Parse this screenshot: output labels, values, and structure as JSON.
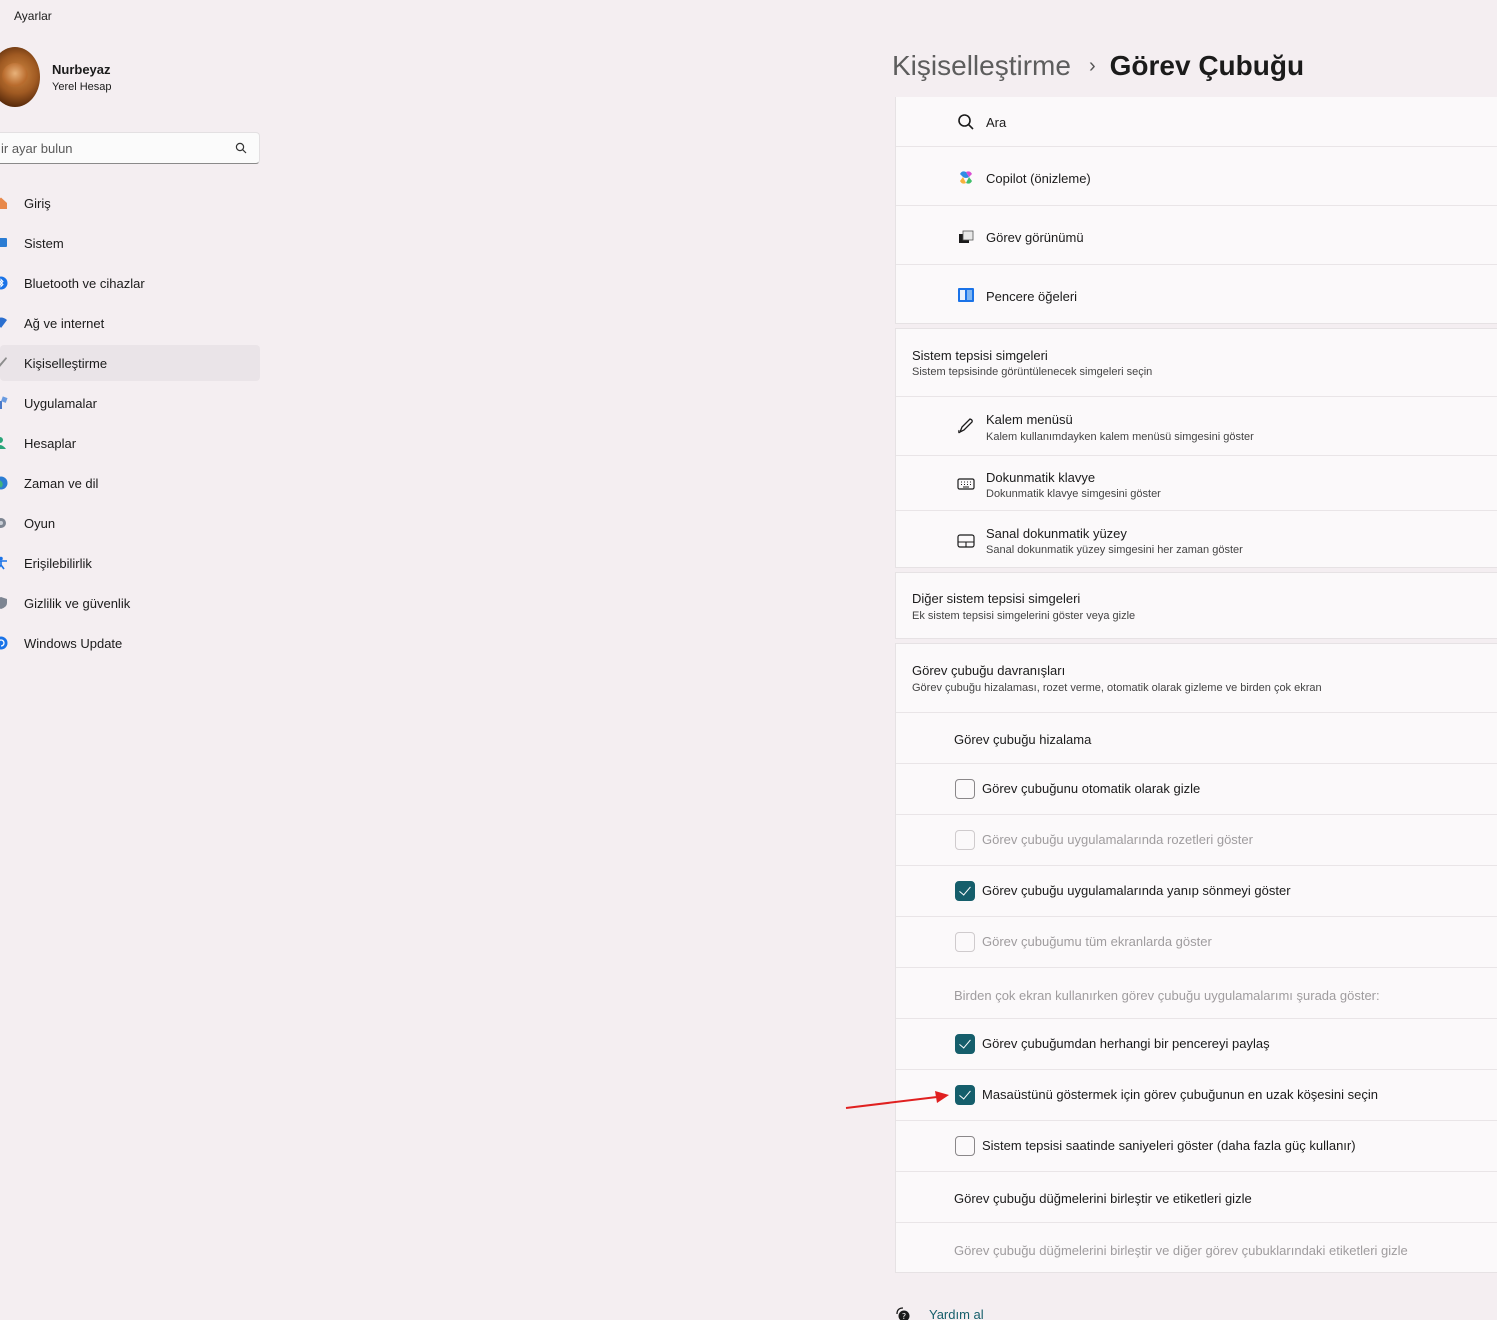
{
  "window": {
    "title": "Ayarlar"
  },
  "profile": {
    "name": "Nurbeyaz",
    "account": "Yerel Hesap"
  },
  "search": {
    "placeholder": "ir ayar bulun"
  },
  "sidebar": {
    "items": [
      {
        "label": "Giriş",
        "icon": "home-icon",
        "color": "#e07a3a"
      },
      {
        "label": "Sistem",
        "icon": "system-icon",
        "color": "#2b7cd3"
      },
      {
        "label": "Bluetooth ve cihazlar",
        "icon": "bluetooth-icon",
        "color": "#1a73e8"
      },
      {
        "label": "Ağ ve internet",
        "icon": "network-icon",
        "color": "#2b6fcf"
      },
      {
        "label": "Kişiselleştirme",
        "icon": "brush-icon",
        "color": "#888888",
        "active": true
      },
      {
        "label": "Uygulamalar",
        "icon": "apps-icon",
        "color": "#4b79c9"
      },
      {
        "label": "Hesaplar",
        "icon": "accounts-icon",
        "color": "#2aa57a"
      },
      {
        "label": "Zaman ve dil",
        "icon": "globe-icon",
        "color": "#2b7cd3"
      },
      {
        "label": "Oyun",
        "icon": "gamepad-icon",
        "color": "#7d8592"
      },
      {
        "label": "Erişilebilirlik",
        "icon": "accessibility-icon",
        "color": "#1a73e8"
      },
      {
        "label": "Gizlilik ve güvenlik",
        "icon": "shield-icon",
        "color": "#7d8592"
      },
      {
        "label": "Windows Update",
        "icon": "update-icon",
        "color": "#1a73e8"
      }
    ]
  },
  "header": {
    "parent": "Kişiselleştirme",
    "separator": "›",
    "current": "Görev Çubuğu"
  },
  "taskbar_items": {
    "ara": "Ara",
    "copilot": "Copilot (önizleme)",
    "task_view": "Görev görünümü",
    "widgets": "Pencere öğeleri"
  },
  "tray_icons": {
    "title": "Sistem tepsisi simgeleri",
    "subtitle": "Sistem tepsisinde görüntülenecek simgeleri seçin",
    "pen": {
      "label": "Kalem menüsü",
      "sub": "Kalem kullanımdayken kalem menüsü simgesini göster"
    },
    "keyboard": {
      "label": "Dokunmatik klavye",
      "sub": "Dokunmatik klavye simgesini göster"
    },
    "touchpad": {
      "label": "Sanal dokunmatik yüzey",
      "sub": "Sanal dokunmatik yüzey simgesini her zaman göster"
    }
  },
  "other_tray": {
    "title": "Diğer sistem tepsisi simgeleri",
    "subtitle": "Ek sistem tepsisi simgelerini göster veya gizle"
  },
  "behaviors": {
    "title": "Görev çubuğu davranışları",
    "subtitle": "Görev çubuğu hizalaması, rozet verme, otomatik olarak gizleme ve birden çok ekran",
    "alignment": "Görev çubuğu hizalama",
    "auto_hide": {
      "label": "Görev çubuğunu otomatik olarak gizle",
      "checked": false
    },
    "badges": {
      "label": "Görev çubuğu uygulamalarında rozetleri göster",
      "checked": false,
      "disabled": true
    },
    "flashing": {
      "label": "Görev çubuğu uygulamalarında yanıp sönmeyi göster",
      "checked": true
    },
    "all_displays": {
      "label": "Görev çubuğumu tüm ekranlarda göster",
      "checked": false,
      "disabled": true
    },
    "multi_display": "Birden çok ekran kullanırken görev çubuğu uygulamalarımı şurada göster:",
    "share_window": {
      "label": "Görev çubuğumdan herhangi bir pencereyi paylaş",
      "checked": true
    },
    "far_corner": {
      "label": "Masaüstünü göstermek için görev çubuğunun en uzak köşesini seçin",
      "checked": true
    },
    "seconds": {
      "label": "Sistem tepsisi saatinde saniyeleri göster (daha fazla güç kullanır)",
      "checked": false
    },
    "combine": "Görev çubuğu düğmelerini birleştir ve etiketleri gizle",
    "combine_other": "Görev çubuğu düğmelerini birleştir ve diğer görev çubuklarındaki etiketleri gizle"
  },
  "help": {
    "label": "Yardım al"
  },
  "colors": {
    "accent": "#155e6b",
    "annotation_arrow": "#e02020"
  }
}
